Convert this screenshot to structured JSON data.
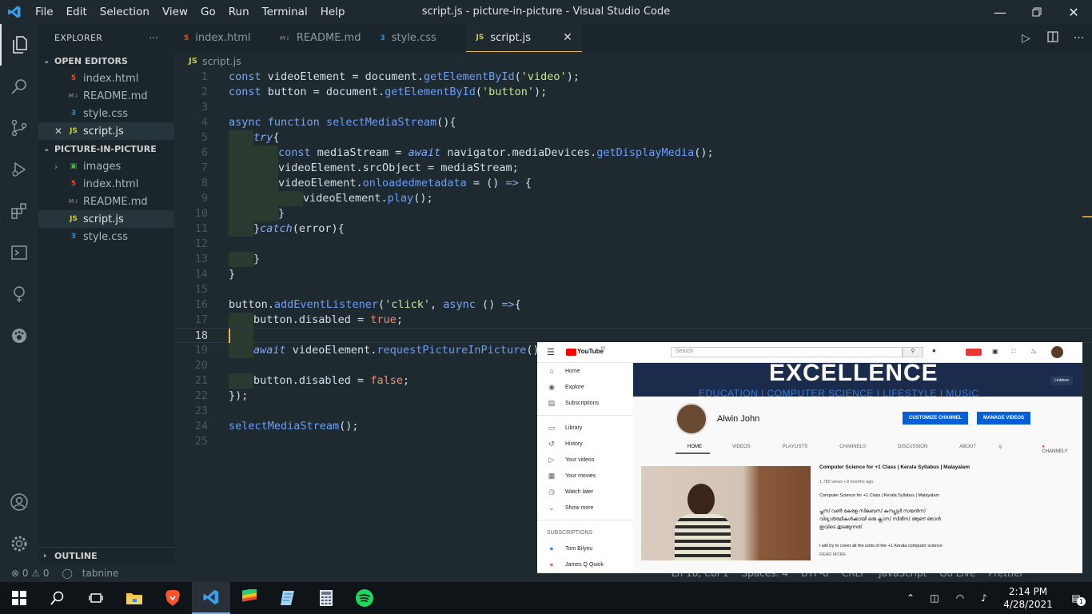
{
  "titlebar": {
    "title": "script.js - picture-in-picture - Visual Studio Code",
    "menu": [
      "File",
      "Edit",
      "Selection",
      "View",
      "Go",
      "Run",
      "Terminal",
      "Help"
    ]
  },
  "sidebar": {
    "header": "EXPLORER",
    "open_editors_label": "OPEN EDITORS",
    "open_editors": [
      {
        "name": "index.html",
        "type": "html"
      },
      {
        "name": "README.md",
        "type": "md"
      },
      {
        "name": "style.css",
        "type": "css"
      },
      {
        "name": "script.js",
        "type": "js"
      }
    ],
    "project_label": "PICTURE-IN-PICTURE",
    "project_files": [
      {
        "name": "images",
        "type": "folder"
      },
      {
        "name": "index.html",
        "type": "html"
      },
      {
        "name": "README.md",
        "type": "md"
      },
      {
        "name": "script.js",
        "type": "js"
      },
      {
        "name": "style.css",
        "type": "css"
      }
    ],
    "outline_label": "OUTLINE"
  },
  "tabs": [
    {
      "label": "index.html",
      "icon": "html5-icon"
    },
    {
      "label": "README.md",
      "icon": "markdown-icon"
    },
    {
      "label": "style.css",
      "icon": "css3-icon"
    },
    {
      "label": "script.js",
      "icon": "js-icon"
    }
  ],
  "breadcrumb": "script.js",
  "editor": {
    "current_line": 18,
    "line_numbers": [
      "1",
      "2",
      "3",
      "4",
      "5",
      "6",
      "7",
      "8",
      "9",
      "10",
      "11",
      "12",
      "13",
      "14",
      "15",
      "16",
      "17",
      "18",
      "19",
      "20",
      "21",
      "22",
      "23",
      "24",
      "25"
    ]
  },
  "statusbar": {
    "problems": "⊗ 0 ⚠ 0",
    "tabnine": "tabnine",
    "position": "Ln 18, Col 1",
    "spaces": "Spaces: 4",
    "encoding": "UTF-8",
    "eol": "CRLF",
    "language": "JavaScript",
    "golive": "Go Live",
    "prettier": "Prettier"
  },
  "taskbar": {
    "time": "2:14 PM",
    "date": "4/28/2021",
    "notification_count": "1"
  },
  "pip": {
    "logo": "YouTube",
    "logo_region": "IN",
    "search_placeholder": "Search",
    "side": [
      "Home",
      "Explore",
      "Subscriptions",
      "Library",
      "History",
      "Your videos",
      "Your movies",
      "Watch later",
      "Show more"
    ],
    "subscriptions_label": "SUBSCRIPTIONS",
    "subs": [
      "Tom Bilyeu",
      "James Q Quick"
    ],
    "banner_title": "EXCELLENCE",
    "banner_sub": "EDUCATION | COMPUTER SCIENCE | LIFESTYLE | MUSIC",
    "banner_badge": "Linktree",
    "channel_name": "Alwin John",
    "customize_btn": "CUSTOMIZE CHANNEL",
    "manage_btn": "MANAGE VIDEOS",
    "channel_tabs": [
      "HOME",
      "VIDEOS",
      "PLAYLISTS",
      "CHANNELS",
      "DISCUSSION",
      "ABOUT"
    ],
    "channely": "CHANNELY",
    "video_title": "Computer Science for +1 Class | Kerala Syllabus | Malayalam",
    "video_meta": "1,785 views • 8 months ago",
    "video_desc1": "Computer Science for +1 Class | Kerala Syllabus | Malayalam",
    "video_desc2": "പ്ലസ് വൺ കേരള സിലബസ് കമ്പ്യൂട്ടർ സയൻസ്",
    "video_desc3": "വിദ്യാർത്ഥികൾക്കായി ഒരു ക്ലാസ് സീരീസ് ആണ് ഞാൻ",
    "video_desc4": "ഇവിടെ തുടങ്ങുന്നത്.",
    "video_desc5": "I will try to cover all the units of the +1 Kerala computer science",
    "read_more": "READ MORE"
  },
  "colors": {
    "accent": "#e6b450",
    "vscode_blue": "#3c9ee8",
    "youtube_red": "#ff0000",
    "yt_button": "#065fd4"
  }
}
